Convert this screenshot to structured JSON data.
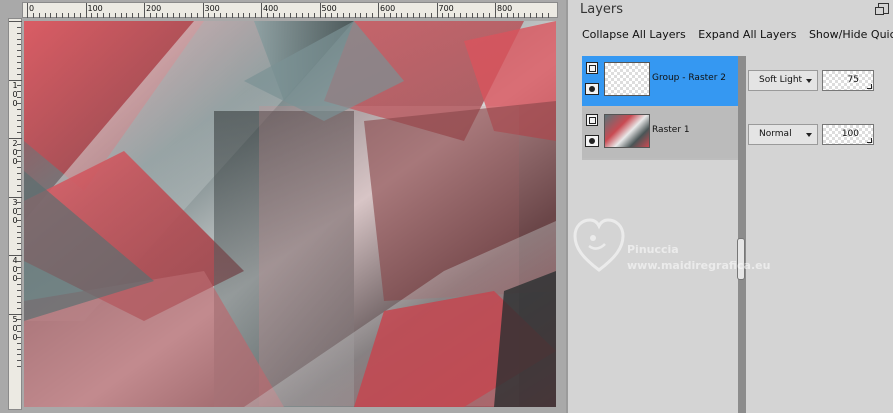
{
  "ruler": {
    "horizontal_labels": [
      "0",
      "100",
      "200",
      "300",
      "400",
      "500",
      "600",
      "700",
      "800"
    ],
    "vertical_labels": [
      [
        "1",
        "0",
        "0"
      ],
      [
        "2",
        "0",
        "0"
      ],
      [
        "3",
        "0",
        "0"
      ],
      [
        "4",
        "0",
        "0"
      ],
      [
        "5",
        "0",
        "0"
      ]
    ]
  },
  "panel": {
    "title": "Layers",
    "toolbar": {
      "collapse_label": "Collapse All Layers",
      "expand_label": "Expand All Layers",
      "showhide_label": "Show/Hide Quick Sea"
    },
    "layers": [
      {
        "name": "Group - Raster 2",
        "blend_mode": "Soft Light",
        "opacity": "75",
        "selected": true
      },
      {
        "name": "Raster 1",
        "blend_mode": "Normal",
        "opacity": "100",
        "selected": false
      }
    ]
  },
  "watermark": {
    "line1": "Pinuccia",
    "line2": "www.maidiregrafica.eu"
  },
  "colors": {
    "accent_selected": "#3598f2",
    "image_red": "#c94a52",
    "image_teal": "#5b7478"
  }
}
